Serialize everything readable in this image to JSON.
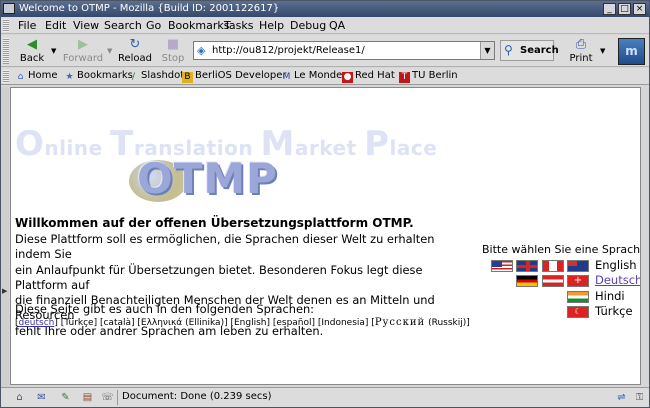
{
  "window": {
    "title": "Welcome to OTMP - Mozilla {Build ID: 2001122617}"
  },
  "menu": [
    "File",
    "Edit",
    "View",
    "Search",
    "Go",
    "Bookmarks",
    "Tasks",
    "Help",
    "Debug",
    "QA"
  ],
  "nav": {
    "back": "Back",
    "forward": "Forward",
    "reload": "Reload",
    "stop": "Stop",
    "url": "http://ou812/projekt/Release1/",
    "search": "Search",
    "print": "Print"
  },
  "bookmarks": [
    "Home",
    "Bookmarks",
    "Slashdot",
    "BerliOS Developer",
    "Le Monde",
    "Red Hat",
    "TU Berlin"
  ],
  "page": {
    "banner": [
      "O",
      "nline ",
      "T",
      "ranslation ",
      "M",
      "arket ",
      "P",
      "lace"
    ],
    "logo": "OTMP",
    "welcome_title": "Willkommen auf der offenen Übersetzungsplattform OTMP.",
    "welcome_lines": [
      "Diese Plattform soll es ermöglichen, die Sprachen dieser Welt zu erhalten indem Sie",
      "ein Anlaufpunkt für Übersetzungen bietet. Besonderen Fokus legt diese Plattform auf",
      "die finanziell Benachteiligten Menschen der Welt denen es an Mitteln und Resourcen",
      "fehlt Ihre oder andrer Sprachen am leben zu erhalten."
    ],
    "also": "Diese Seite gibt es auch in den folgenden Sprachen:",
    "languages": {
      "open": "[",
      "deutsch": "deutsch",
      "rest": "] [Türkçe] [català] [Ελληνικά (Ellinika)] [English] [español] [Indonesia] [",
      "russian": "Русский",
      "tail": " (Russkij)]"
    },
    "choose": "Bitte wählen Sie eine Sprache:",
    "choices": [
      "English",
      "Deutsch",
      "Hindi",
      "Türkçe"
    ]
  },
  "status": {
    "text": "Document: Done (0.239 secs)"
  },
  "colors": {
    "titlebar": "#33486b",
    "link": "#5a3fb6",
    "banner": "#dde2f5",
    "logo": "#9aa7d8"
  },
  "icons": [
    "back-arrow-icon",
    "forward-arrow-icon",
    "reload-icon",
    "stop-icon",
    "page-icon",
    "search-icon",
    "printer-icon",
    "mozilla-throbber-icon"
  ]
}
